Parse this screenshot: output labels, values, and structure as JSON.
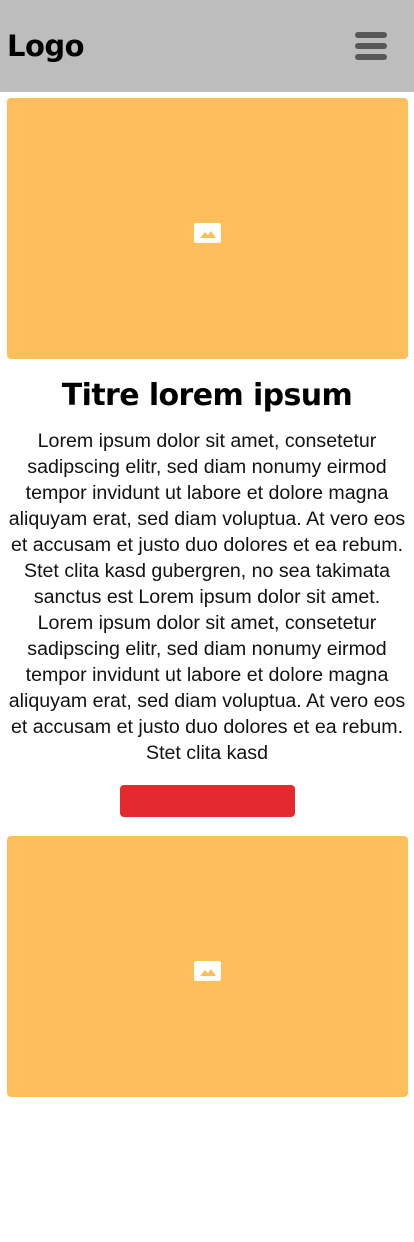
{
  "header": {
    "logo_text": "Logo"
  },
  "icons": {
    "menu": "hamburger-menu-icon",
    "image": "image-placeholder-icon"
  },
  "main": {
    "title": "Titre lorem ipsum",
    "body": "Lorem ipsum dolor sit amet, consetetur sadipscing elitr, sed diam nonumy eirmod tempor invidunt ut labore et dolore magna aliquyam erat, sed diam voluptua. At vero eos et accusam et justo duo dolores et ea rebum. Stet clita kasd gubergren, no sea takimata sanctus est Lorem ipsum dolor sit amet. Lorem ipsum dolor sit amet, consetetur sadipscing elitr, sed diam nonumy eirmod tempor invidunt ut labore et dolore magna aliquyam erat, sed diam voluptua. At vero eos et accusam et justo duo dolores et ea rebum. Stet clita kasd",
    "button_label": ""
  },
  "colors": {
    "header_background": "#bdbdbd",
    "menu_icon": "#575757",
    "image_placeholder": "#ffbe5c",
    "button": "#e42a2e",
    "text": "#000000"
  }
}
